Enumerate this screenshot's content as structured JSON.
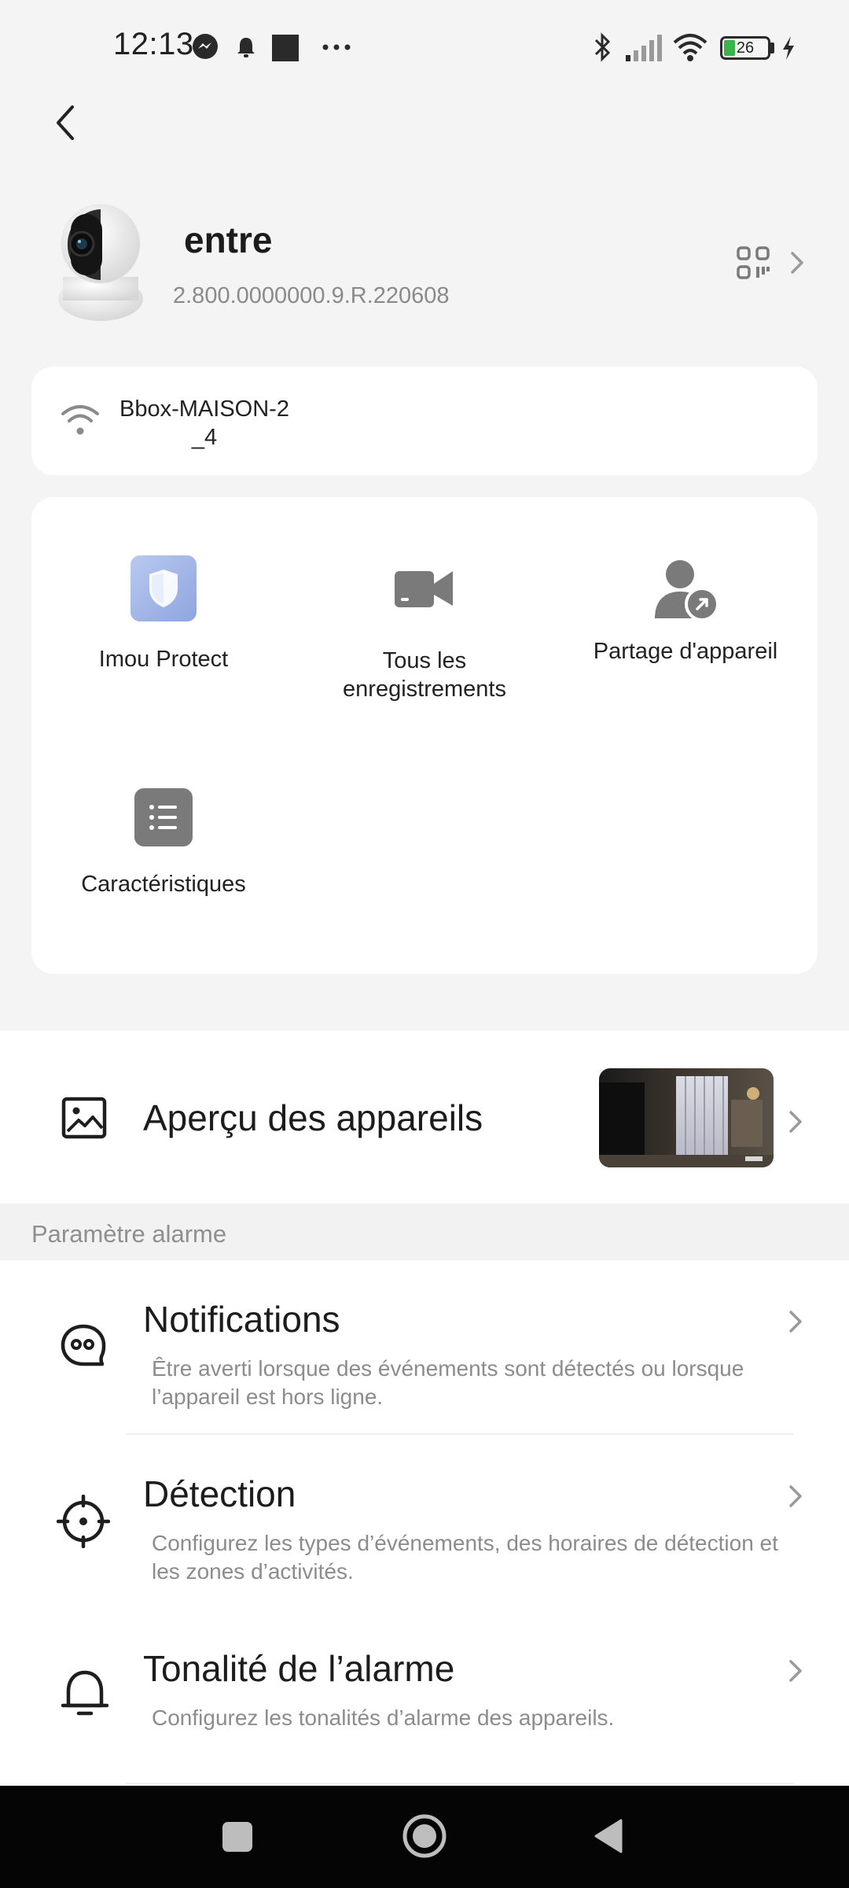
{
  "status_bar": {
    "time": "12:13",
    "battery": "26",
    "icons": [
      "messenger-icon",
      "bell-icon",
      "square-notification-icon",
      "more-dots-icon",
      "bluetooth-icon",
      "signal-icon",
      "wifi-icon",
      "battery-icon",
      "charging-icon"
    ]
  },
  "device": {
    "name": "entre",
    "firmware": "2.800.0000000.9.R.220608"
  },
  "wifi": {
    "ssid": "Bbox-MAISON-2_4"
  },
  "menu": {
    "imou_protect": "Imou Protect",
    "recordings_line1": "Tous les",
    "recordings_line2": "enregistrements",
    "share": "Partage d'appareil",
    "features": "Caractéristiques"
  },
  "preview": {
    "title": "Aperçu des appareils"
  },
  "alarm_section": {
    "header": "Paramètre alarme",
    "items": [
      {
        "title": "Notifications",
        "desc_line1": "Être averti lorsque des événements sont détectés ou lorsque",
        "desc_line2": "l’appareil est hors ligne."
      },
      {
        "title": "Détection",
        "desc_line1": "Configurez les types d’événements, des horaires de détection et",
        "desc_line2": "les zones d’activités."
      },
      {
        "title": "Tonalité de l’alarme",
        "desc_line1": "Configurez les tonalités d’alarme des appareils."
      }
    ]
  },
  "colors": {
    "accent_shield": "#9fb4e8",
    "icon_gray": "#7a7a7a",
    "background": "#f4f4f4",
    "navbar": "#050505"
  }
}
